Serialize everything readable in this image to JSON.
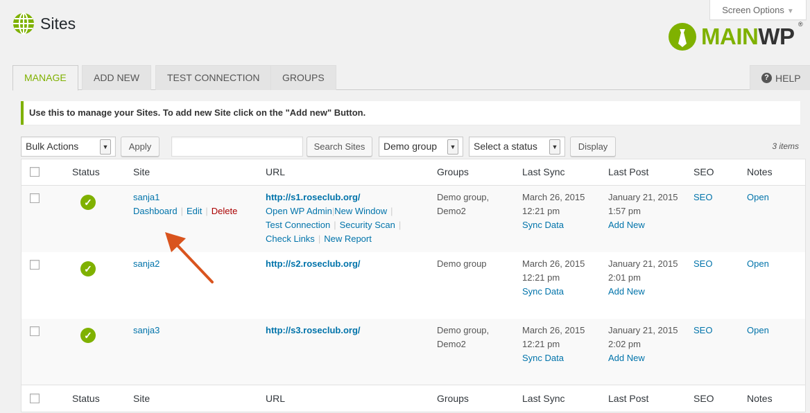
{
  "screen_options": {
    "label": "Screen Options"
  },
  "page": {
    "title": "Sites"
  },
  "logo": {
    "main": "MAIN",
    "wp": "WP",
    "reg": "®"
  },
  "tabs": {
    "manage": "MANAGE",
    "add_new": "ADD NEW",
    "test_connection": "TEST CONNECTION",
    "groups": "GROUPS",
    "help": "HELP"
  },
  "notice": "Use this to manage your Sites. To add new Site click on the \"Add new\" Button.",
  "toolbar": {
    "bulk_actions": "Bulk Actions",
    "apply": "Apply",
    "search_value": "",
    "search_button": "Search Sites",
    "group_select": "Demo group",
    "status_select": "Select a status",
    "display_button": "Display",
    "items_count": "3 items"
  },
  "columns": {
    "status": "Status",
    "site": "Site",
    "url": "URL",
    "groups": "Groups",
    "last_sync": "Last Sync",
    "last_post": "Last Post",
    "seo": "SEO",
    "notes": "Notes"
  },
  "row_actions": {
    "dashboard": "Dashboard",
    "edit": "Edit",
    "delete": "Delete",
    "open_wp_admin": "Open WP Admin",
    "new_window": "New Window",
    "test_connection": "Test Connection",
    "security_scan": "Security Scan",
    "check_links": "Check Links",
    "new_report": "New Report",
    "sync_data": "Sync Data",
    "add_new": "Add New"
  },
  "rows": [
    {
      "site": "sanja1",
      "url": "http://s1.roseclub.org/",
      "groups": [
        "Demo group,",
        "Demo2"
      ],
      "last_sync_date": "March 26, 2015",
      "last_sync_time": "12:21 pm",
      "last_post_date": "January 21, 2015",
      "last_post_time": "1:57 pm",
      "seo": "SEO",
      "notes": "Open"
    },
    {
      "site": "sanja2",
      "url": "http://s2.roseclub.org/",
      "groups": [
        "Demo group",
        ""
      ],
      "last_sync_date": "March 26, 2015",
      "last_sync_time": "12:21 pm",
      "last_post_date": "January 21, 2015",
      "last_post_time": "2:01 pm",
      "seo": "SEO",
      "notes": "Open"
    },
    {
      "site": "sanja3",
      "url": "http://s3.roseclub.org/",
      "groups": [
        "Demo group,",
        "Demo2"
      ],
      "last_sync_date": "March 26, 2015",
      "last_sync_time": "12:21 pm",
      "last_post_date": "January 21, 2015",
      "last_post_time": "2:02 pm",
      "seo": "SEO",
      "notes": "Open"
    }
  ],
  "colors": {
    "accent": "#7fb100",
    "link": "#0073aa",
    "delete": "#aa0000",
    "arrow": "#d9541e"
  }
}
